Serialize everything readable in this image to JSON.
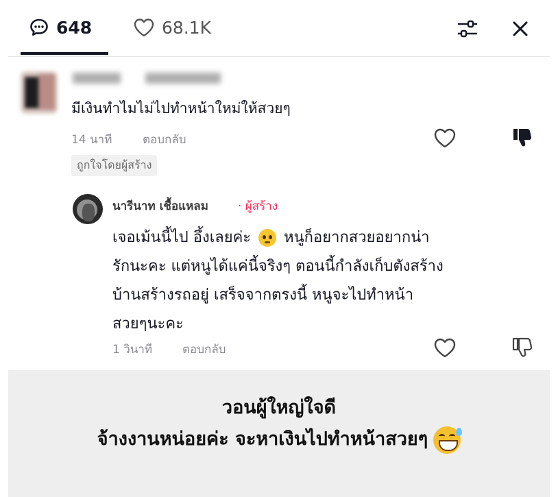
{
  "header": {
    "comments_count": "648",
    "likes_count": "68.1K",
    "icons": {
      "comments": "comment-bubble-icon",
      "likes": "heart-outline-icon",
      "filter": "sliders-icon",
      "close": "close-icon"
    }
  },
  "comment1": {
    "text": "มีเงินทำไมไม่ไปทำหน้าใหม่ให้สวยๆ",
    "time": "14 นาที",
    "reply_label": "ตอบกลับ",
    "creator_liked": "ถูกใจโดยผู้สร้าง"
  },
  "reply": {
    "name": "นารีนาท เชื้อแหลม",
    "author_tag": "· ผู้สร้าง",
    "line1a": "เจอเม้นนี้ไป อึ้งเลยค่ะ",
    "line1b": "หนูก็อยากสวยอยากน่า",
    "line2": "รักนะคะ แต่หนูได้แค่นี้จริงๆ ตอนนี้กำลังเก็บตังสร้าง",
    "line3": "บ้านสร้างรถอยู่ เสร็จจากตรงนี้ หนูจะไปทำหน้า",
    "line4": "สวยๆนะคะ",
    "time": "1 วินาที",
    "reply_label": "ตอบกลับ"
  },
  "caption": {
    "line1": "วอนผู้ใหญ่ใจดี",
    "line2": "จ้างงานหน่อยค่ะ จะหาเงินไปทำหน้าสวยๆ"
  }
}
